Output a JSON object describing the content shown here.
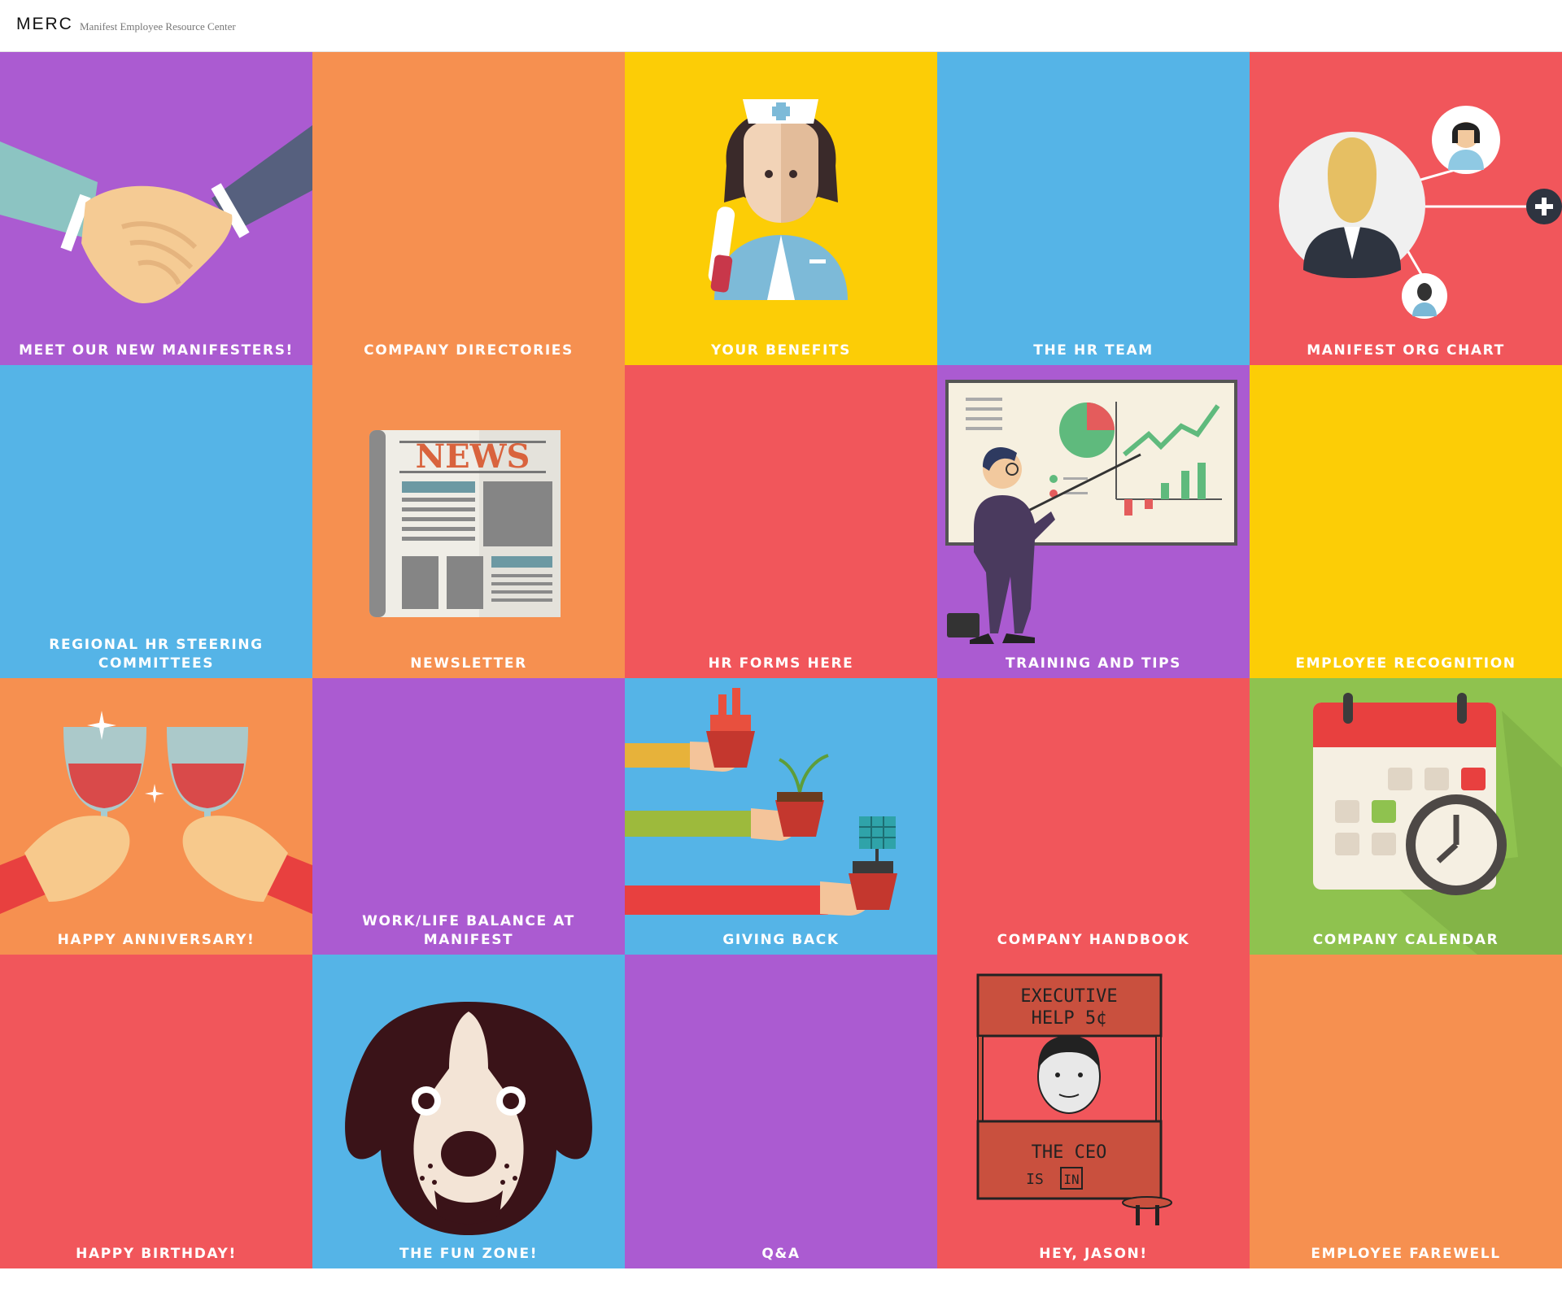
{
  "header": {
    "brand": "MERC",
    "tagline": "Manifest Employee Resource Center"
  },
  "colors": {
    "purple": "#AB5BD1",
    "orange": "#F69050",
    "yellow": "#FCCD06",
    "blue": "#55B4E7",
    "red": "#F1565B",
    "green": "#8FC24F"
  },
  "tiles": [
    {
      "label": "MEET OUR NEW MANIFESTERS!",
      "color": "#AB5BD1",
      "icon": "handshake-icon"
    },
    {
      "label": "COMPANY DIRECTORIES",
      "color": "#F69050",
      "icon": ""
    },
    {
      "label": "YOUR BENEFITS",
      "color": "#FCCD06",
      "icon": "nurse-icon"
    },
    {
      "label": "THE HR TEAM",
      "color": "#55B4E7",
      "icon": ""
    },
    {
      "label": "MANIFEST ORG CHART",
      "color": "#F1565B",
      "icon": "org-chart-icon"
    },
    {
      "label": "REGIONAL HR STEERING COMMITTEES",
      "color": "#55B4E7",
      "icon": ""
    },
    {
      "label": "NEWSLETTER",
      "color": "#F69050",
      "icon": "newspaper-icon"
    },
    {
      "label": "HR FORMS HERE",
      "color": "#F1565B",
      "icon": ""
    },
    {
      "label": "TRAINING AND TIPS",
      "color": "#AB5BD1",
      "icon": "presenter-icon"
    },
    {
      "label": "EMPLOYEE RECOGNITION",
      "color": "#FCCD06",
      "icon": ""
    },
    {
      "label": "HAPPY ANNIVERSARY!",
      "color": "#F69050",
      "icon": "wine-toast-icon"
    },
    {
      "label": "WORK/LIFE BALANCE AT MANIFEST",
      "color": "#AB5BD1",
      "icon": ""
    },
    {
      "label": "GIVING BACK",
      "color": "#55B4E7",
      "icon": "giving-hands-icon"
    },
    {
      "label": "COMPANY HANDBOOK",
      "color": "#F1565B",
      "icon": ""
    },
    {
      "label": "COMPANY CALENDAR",
      "color": "#8FC24F",
      "icon": "calendar-clock-icon"
    },
    {
      "label": "HAPPY BIRTHDAY!",
      "color": "#F1565B",
      "icon": ""
    },
    {
      "label": "THE FUN ZONE!",
      "color": "#55B4E7",
      "icon": "dog-face-icon"
    },
    {
      "label": "Q&A",
      "color": "#AB5BD1",
      "icon": ""
    },
    {
      "label": "HEY, JASON!",
      "color": "#F1565B",
      "icon": "ceo-booth-icon"
    },
    {
      "label": "EMPLOYEE FAREWELL",
      "color": "#F69050",
      "icon": ""
    }
  ],
  "art_text": {
    "news": "NEWS",
    "booth_top_1": "EXECUTIVE",
    "booth_top_2": "HELP 5¢",
    "booth_bottom_1": "THE CEO",
    "booth_bottom_2": "IS",
    "booth_in": "IN"
  }
}
